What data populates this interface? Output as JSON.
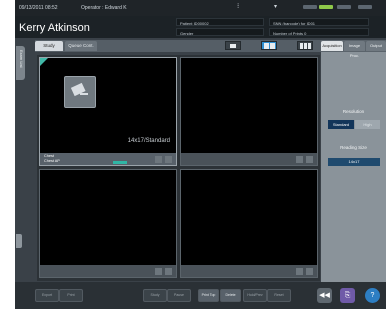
{
  "topbar": {
    "datetime": "09/13/2011 08:52",
    "operator": "Operator : Edward K",
    "status_colors": {
      "normal": "#5c6670",
      "active": "#8fc94a"
    }
  },
  "header": {
    "patient_name": "Kerry Atkinson",
    "fields": [
      "Patient ID00002",
      "Gender",
      "SNN (barcode) for ID01",
      "Number of Prints 0"
    ]
  },
  "main_tabs": [
    "Study",
    "Queue Cont."
  ],
  "layout_buttons": [
    "single",
    "2x2",
    "3x2"
  ],
  "side_tab": "Exam List",
  "cells": [
    {
      "film_label": "14x17/Standard",
      "strip_rows": [
        "Chest",
        "Chest AP"
      ],
      "selected": true
    },
    {
      "film_label": "",
      "strip_rows": [],
      "selected": false
    },
    {
      "film_label": "",
      "strip_rows": [],
      "selected": false
    },
    {
      "film_label": "",
      "strip_rows": [],
      "selected": false
    }
  ],
  "right_panel": {
    "tabs": [
      "Acquisition",
      "Image Proc.",
      "Output"
    ],
    "resolution_label": "Resolution",
    "resolution_options": [
      "Standard",
      "High"
    ],
    "reading_size_label": "Reading Size",
    "reading_size_value": "14x17",
    "accent": "#12355a"
  },
  "bottom": {
    "buttons": [
      "Export",
      "Print",
      "Study",
      "Pause",
      "Print Top",
      "Delete",
      "Hold/Prev",
      "Reset"
    ],
    "nav_icons": [
      "rewind-icon",
      "exit-icon",
      "help-icon"
    ]
  }
}
